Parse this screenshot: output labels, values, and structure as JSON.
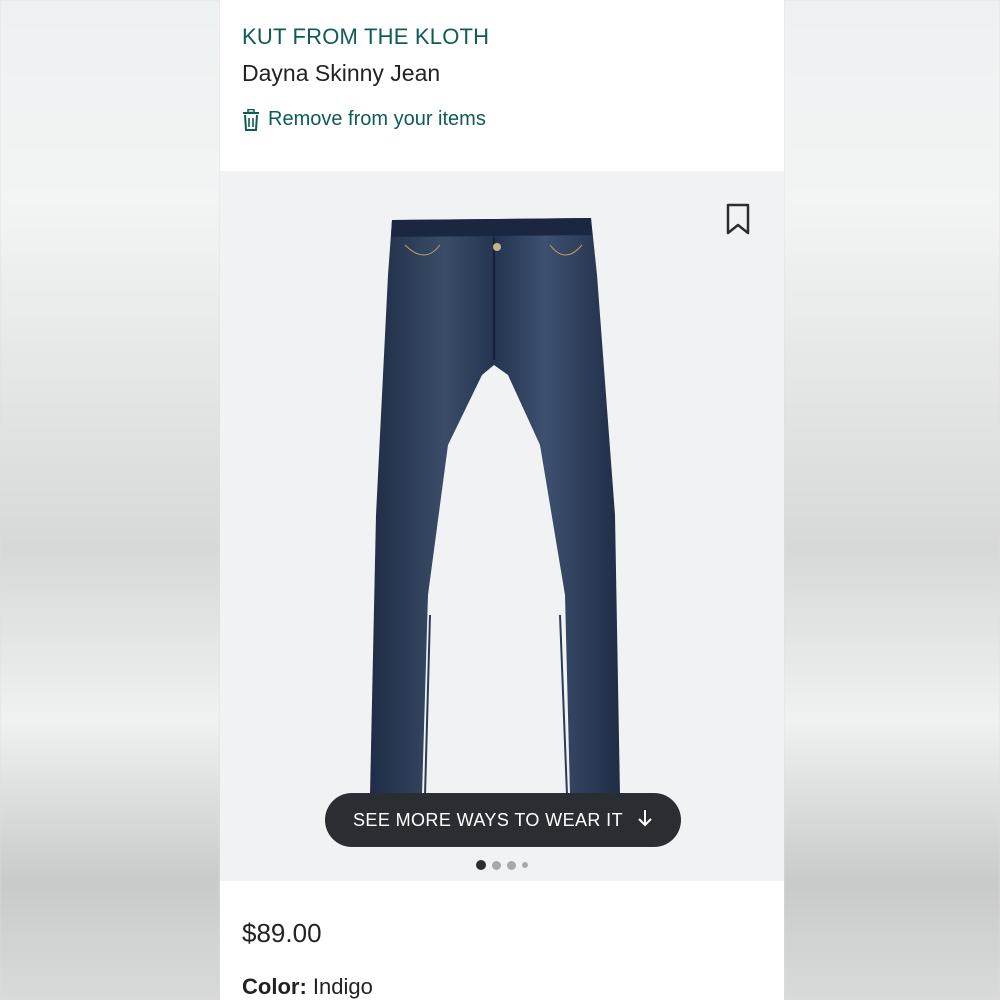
{
  "product": {
    "brand": "KUT FROM THE KLOTH",
    "name": "Dayna Skinny Jean",
    "remove_label": "Remove from your items",
    "see_more_label": "SEE MORE WAYS TO WEAR IT",
    "price": "$89.00",
    "color_label": "Color:",
    "color_value": "Indigo",
    "image_page": {
      "current": 1,
      "total": 4
    }
  },
  "icons": {
    "remove": "trash-icon",
    "bookmark": "bookmark-icon",
    "see_more": "arrow-down-icon"
  },
  "colors": {
    "brand_accent": "#0f5c55",
    "button_bg": "#2a2e33",
    "image_bg": "#f1f2f4"
  }
}
